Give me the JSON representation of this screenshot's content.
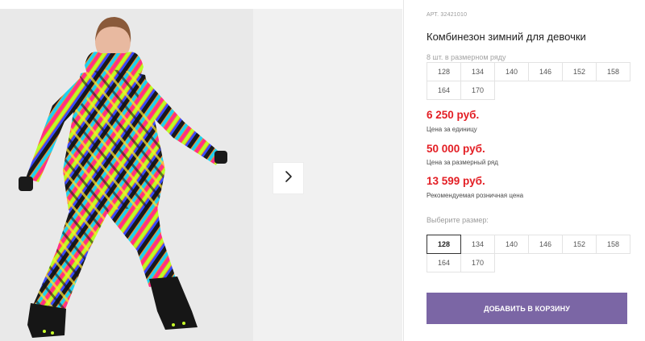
{
  "product": {
    "sku_label": "АРТ. 32421010",
    "title": "Комбинезон зимний для девочки"
  },
  "size_run": {
    "note": "8 шт. в размерном ряду",
    "sizes": [
      "128",
      "134",
      "140",
      "146",
      "152",
      "158",
      "164",
      "170"
    ]
  },
  "prices": [
    {
      "value": "6 250 руб.",
      "caption": "Цена за единицу"
    },
    {
      "value": "50 000 руб.",
      "caption": "Цена за размерный ряд"
    },
    {
      "value": "13 599 руб.",
      "caption": "Рекомендуемая розничная цена"
    }
  ],
  "size_picker": {
    "label": "Выберите размер:",
    "sizes": [
      "128",
      "134",
      "140",
      "146",
      "152",
      "158",
      "164",
      "170"
    ],
    "selected": "128"
  },
  "actions": {
    "add_to_cart": "ДОБАВИТЬ В КОРЗИНУ"
  },
  "colors": {
    "price_red": "#e31e24",
    "cart_button": "#7b66a5",
    "gallery_bg": "#e9e9e9"
  },
  "icons": {
    "next": "chevron-right-icon"
  }
}
